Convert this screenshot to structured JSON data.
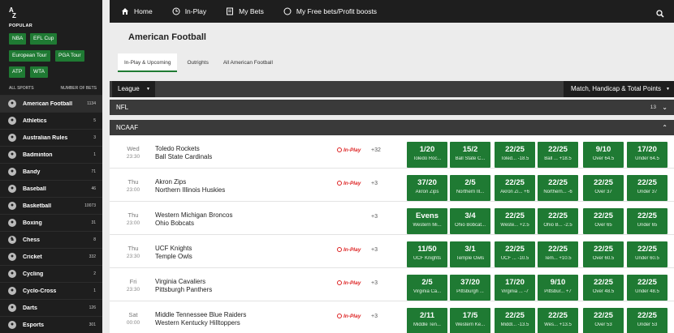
{
  "sidebar": {
    "az": [
      "A",
      "Z"
    ],
    "popular_label": "POPULAR",
    "popular": [
      "NBA",
      "EFL Cup",
      "European Tour",
      "PGA Tour",
      "ATP",
      "WTA"
    ],
    "all_sports_label": "ALL SPORTS",
    "number_of_bets_label": "NUMBER OF BETS",
    "sports": [
      {
        "name": "American Football",
        "count": "1134",
        "icon": "football-icon"
      },
      {
        "name": "Athletics",
        "count": "5",
        "icon": "athletics-icon"
      },
      {
        "name": "Australian Rules",
        "count": "3",
        "icon": "aussie-rules-icon"
      },
      {
        "name": "Badminton",
        "count": "1",
        "icon": "shuttlecock-icon"
      },
      {
        "name": "Bandy",
        "count": "71",
        "icon": "bandy-icon"
      },
      {
        "name": "Baseball",
        "count": "46",
        "icon": "baseball-icon"
      },
      {
        "name": "Basketball",
        "count": "10073",
        "icon": "basketball-icon"
      },
      {
        "name": "Boxing",
        "count": "31",
        "icon": "boxing-glove-icon"
      },
      {
        "name": "Chess",
        "count": "8",
        "icon": "chess-knight-icon"
      },
      {
        "name": "Cricket",
        "count": "332",
        "icon": "cricket-icon"
      },
      {
        "name": "Cycling",
        "count": "2",
        "icon": "bicycle-icon"
      },
      {
        "name": "Cyclo-Cross",
        "count": "1",
        "icon": "trophy-icon"
      },
      {
        "name": "Darts",
        "count": "126",
        "icon": "dartboard-icon"
      },
      {
        "name": "Esports",
        "count": "301",
        "icon": "gamepad-icon"
      }
    ]
  },
  "topnav": {
    "home": "Home",
    "inplay": "In-Play",
    "mybets": "My Bets",
    "freebets": "My Free bets/Profit boosts"
  },
  "page_title": "American Football",
  "tabs": [
    "In-Play & Upcoming",
    "Outrights",
    "All American Football"
  ],
  "filters": {
    "league": "League",
    "market": "Match, Handicap & Total Points"
  },
  "sections": {
    "nfl": {
      "name": "NFL",
      "count": "13"
    },
    "ncaaf": {
      "name": "NCAAF"
    }
  },
  "inplay_label": "In-Play",
  "events": [
    {
      "day": "Wed",
      "time": "23:30",
      "team1": "Toledo Rockets",
      "team2": "Ball State Cardinals",
      "inplay": true,
      "more": "+32",
      "odds": [
        {
          "p": "1/20",
          "l": "Toledo Roc..."
        },
        {
          "p": "15/2",
          "l": "Ball State C..."
        },
        {
          "p": "22/25",
          "l": "Toled...  -18.5"
        },
        {
          "p": "22/25",
          "l": "Ball ...  +18.5"
        },
        {
          "p": "9/10",
          "l": "Over 64.5"
        },
        {
          "p": "17/20",
          "l": "Under 64.5"
        }
      ]
    },
    {
      "day": "Thu",
      "time": "23:00",
      "team1": "Akron Zips",
      "team2": "Northern Illinois Huskies",
      "inplay": true,
      "more": "+3",
      "odds": [
        {
          "p": "37/20",
          "l": "Akron Zips"
        },
        {
          "p": "2/5",
          "l": "Northern Ill..."
        },
        {
          "p": "22/25",
          "l": "Akron Zi... +6"
        },
        {
          "p": "22/25",
          "l": "Northern... -6"
        },
        {
          "p": "22/25",
          "l": "Over 37"
        },
        {
          "p": "22/25",
          "l": "Under 37"
        }
      ]
    },
    {
      "day": "Thu",
      "time": "23:00",
      "team1": "Western Michigan Broncos",
      "team2": "Ohio Bobcats",
      "inplay": false,
      "more": "+3",
      "odds": [
        {
          "p": "Evens",
          "l": "Western Mi..."
        },
        {
          "p": "3/4",
          "l": "Ohio Bobcat..."
        },
        {
          "p": "22/25",
          "l": "Weste... +2.5"
        },
        {
          "p": "22/25",
          "l": "Ohio B... -2.5"
        },
        {
          "p": "22/25",
          "l": "Over 65"
        },
        {
          "p": "22/25",
          "l": "Under 65"
        }
      ]
    },
    {
      "day": "Thu",
      "time": "23:30",
      "team1": "UCF Knights",
      "team2": "Temple Owls",
      "inplay": true,
      "more": "+3",
      "odds": [
        {
          "p": "11/50",
          "l": "UCF Knights"
        },
        {
          "p": "3/1",
          "l": "Temple Owls"
        },
        {
          "p": "22/25",
          "l": "UCF ...  -10.5"
        },
        {
          "p": "22/25",
          "l": "Tem... +10.5"
        },
        {
          "p": "22/25",
          "l": "Over 60.5"
        },
        {
          "p": "22/25",
          "l": "Under 60.5"
        }
      ]
    },
    {
      "day": "Fri",
      "time": "23:30",
      "team1": "Virginia Cavaliers",
      "team2": "Pittsburgh Panthers",
      "inplay": true,
      "more": "+3",
      "odds": [
        {
          "p": "2/5",
          "l": "Virginia Ca..."
        },
        {
          "p": "37/20",
          "l": "Pittsburgh ..."
        },
        {
          "p": "17/20",
          "l": "Virginia ...  -7"
        },
        {
          "p": "9/10",
          "l": "Pittsbur... +7"
        },
        {
          "p": "22/25",
          "l": "Over 48.5"
        },
        {
          "p": "22/25",
          "l": "Under 48.5"
        }
      ]
    },
    {
      "day": "Sat",
      "time": "00:00",
      "team1": "Middle Tennessee Blue Raiders",
      "team2": "Western Kentucky Hilltoppers",
      "inplay": true,
      "more": "+3",
      "odds": [
        {
          "p": "2/11",
          "l": "Middle Ten..."
        },
        {
          "p": "17/5",
          "l": "Western Ke..."
        },
        {
          "p": "22/25",
          "l": "Middl... -13.5"
        },
        {
          "p": "22/25",
          "l": "Wes... +13.5"
        },
        {
          "p": "22/25",
          "l": "Over 53"
        },
        {
          "p": "22/25",
          "l": "Under 53"
        }
      ]
    }
  ]
}
